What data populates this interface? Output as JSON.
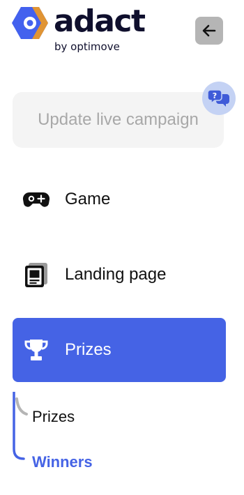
{
  "brand": {
    "name": "adact",
    "tagline": "by optimove",
    "colors": {
      "ink": "#0f0f2d",
      "logo_blue": "#4361ee",
      "logo_orange": "#f29a1f",
      "accent": "#4563e5"
    }
  },
  "header": {
    "back_button": {
      "icon": "arrow-left-icon"
    }
  },
  "update_button": {
    "label": "Update live campaign"
  },
  "help": {
    "icon": "help-chat-icon"
  },
  "nav": {
    "items": [
      {
        "label": "Game",
        "icon": "gamepad-icon",
        "active": false
      },
      {
        "label": "Landing page",
        "icon": "landing-page-icon",
        "active": false
      },
      {
        "label": "Prizes",
        "icon": "trophy-icon",
        "active": true
      }
    ],
    "sub_items": [
      {
        "label": "Prizes",
        "active": false
      },
      {
        "label": "Winners",
        "active": true
      }
    ]
  }
}
